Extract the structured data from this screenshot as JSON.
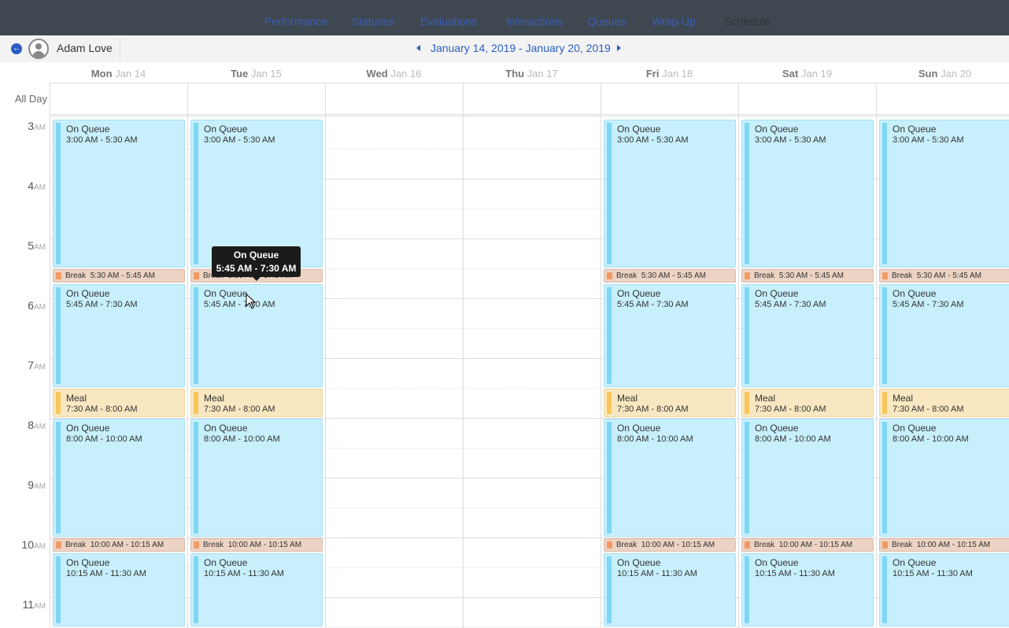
{
  "tabs": [
    {
      "label": "Performance"
    },
    {
      "label": "Statuses"
    },
    {
      "label": "Evaluations"
    },
    {
      "label": "Interactions"
    },
    {
      "label": "Queues"
    },
    {
      "label": "Wrap-Up"
    },
    {
      "label": "Schedule",
      "active": true
    }
  ],
  "header": {
    "user_name": "Adam Love",
    "date_range": "January 14, 2019 - January 20, 2019"
  },
  "days": [
    {
      "name": "Mon",
      "date": "Jan 14"
    },
    {
      "name": "Tue",
      "date": "Jan 15"
    },
    {
      "name": "Wed",
      "date": "Jan 16"
    },
    {
      "name": "Thu",
      "date": "Jan 17"
    },
    {
      "name": "Fri",
      "date": "Jan 18"
    },
    {
      "name": "Sat",
      "date": "Jan 19"
    },
    {
      "name": "Sun",
      "date": "Jan 20"
    }
  ],
  "all_day_label": "All Day",
  "hours": [
    {
      "h": "3",
      "ampm": "AM"
    },
    {
      "h": "4",
      "ampm": "AM"
    },
    {
      "h": "5",
      "ampm": "AM"
    },
    {
      "h": "6",
      "ampm": "AM"
    },
    {
      "h": "7",
      "ampm": "AM"
    },
    {
      "h": "8",
      "ampm": "AM"
    },
    {
      "h": "9",
      "ampm": "AM"
    },
    {
      "h": "10",
      "ampm": "AM"
    },
    {
      "h": "11",
      "ampm": "AM"
    }
  ],
  "scheduled_days": [
    "Mon",
    "Tue",
    "Fri",
    "Sat",
    "Sun"
  ],
  "blocks": [
    {
      "kind": "queue",
      "title": "On Queue",
      "time": "3:00 AM - 5:30 AM",
      "start": 3.0,
      "end": 5.5
    },
    {
      "kind": "brk",
      "title": "Break",
      "time": "5:30 AM - 5:45 AM",
      "start": 5.5,
      "end": 5.75
    },
    {
      "kind": "queue",
      "title": "On Queue",
      "time": "5:45 AM - 7:30 AM",
      "start": 5.75,
      "end": 7.5
    },
    {
      "kind": "meal",
      "title": "Meal",
      "time": "7:30 AM - 8:00 AM",
      "start": 7.5,
      "end": 8.0
    },
    {
      "kind": "queue",
      "title": "On Queue",
      "time": "8:00 AM - 10:00 AM",
      "start": 8.0,
      "end": 10.0
    },
    {
      "kind": "brk",
      "title": "Break",
      "time": "10:00 AM - 10:15 AM",
      "start": 10.0,
      "end": 10.25
    },
    {
      "kind": "queue",
      "title": "On Queue",
      "time": "10:15 AM - 11:30 AM",
      "start": 10.25,
      "end": 11.5
    }
  ],
  "tooltip": {
    "title": "On Queue",
    "time": "5:45 AM - 7:30 AM"
  },
  "colors": {
    "queue": "#c7effc",
    "meal": "#f8e7c0",
    "break": "#ecd3c4",
    "link": "#2b5cc4",
    "topbar": "#3f4751"
  }
}
